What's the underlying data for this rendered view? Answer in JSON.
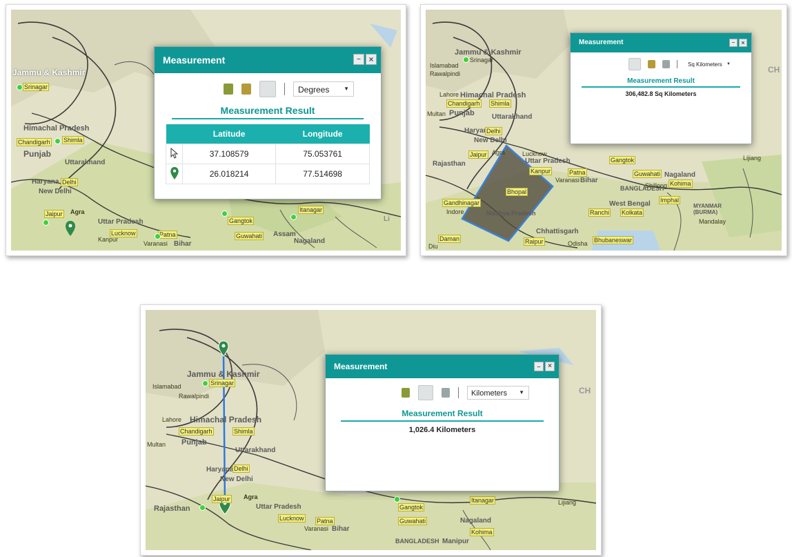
{
  "windows": [
    {
      "title": "Measurement",
      "unit": "Degrees",
      "result_heading": "Measurement Result",
      "columns": [
        "Latitude",
        "Longitude"
      ],
      "rows": [
        {
          "icon": "cursor-icon",
          "latitude": "37.108579",
          "longitude": "75.053761"
        },
        {
          "icon": "map-marker-icon",
          "latitude": "26.018214",
          "longitude": "77.514698"
        }
      ],
      "minimize": "–",
      "close": "×"
    },
    {
      "title": "Measurement",
      "unit": "Sq Kilometers",
      "result_heading": "Measurement Result",
      "result": "306,482.8 Sq Kilometers",
      "minimize": "–",
      "close": "×"
    },
    {
      "title": "Measurement",
      "unit": "Kilometers",
      "result_heading": "Measurement Result",
      "result": "1,026.4 Kilometers",
      "minimize": "–",
      "close": "×"
    }
  ],
  "map_labels": {
    "m1": [
      "Jammu & Kashmir",
      "Srinagar",
      "Himachal Pradesh",
      "Shimla",
      "Chandigarh",
      "Punjab",
      "Uttarakhand",
      "Haryana",
      "Delhi",
      "New Delhi",
      "Jaipur",
      "Agra",
      "Uttar Pradesh",
      "Lucknow",
      "Kanpur",
      "Patna",
      "Varanasi",
      "Bihar",
      "Gangtok",
      "Guwahati",
      "Itanagar",
      "Nagaland",
      "Assam",
      "Li"
    ],
    "m2": [
      "Jammu & Kashmir",
      "Srinagar",
      "Islamabad",
      "Rawalpindi",
      "Lahore",
      "Himachal Pradesh",
      "Chandigarh",
      "Shimla",
      "Punjab",
      "Multan",
      "Uttarakhand",
      "Haryana",
      "Delhi",
      "New Delhi",
      "Jaipur",
      "Agra",
      "Lucknow",
      "Rajasthan",
      "Uttar Pradesh",
      "Kanpur",
      "Patna",
      "Varanasi",
      "Bihar",
      "Gandhinagar",
      "Indore",
      "Bhopal",
      "Madhya Pradesh",
      "Daman",
      "Diu",
      "Raipur",
      "Chhattisgarh",
      "Odisha",
      "Bhubaneswar",
      "Ranchi",
      "West Bengal",
      "Kolkata",
      "BANGLADESH",
      "Gangtok",
      "Guwahati",
      "Shillong",
      "Nagaland",
      "Kohima",
      "Imphal",
      "MYANMAR (BURMA)",
      "Mandalay",
      "Lijiang",
      "CH"
    ],
    "m3": [
      "Jammu & Kashmir",
      "Srinagar",
      "Islamabad",
      "Rawalpindi",
      "Lahore",
      "Himachal Pradesh",
      "Chandigarh",
      "Shimla",
      "Punjab",
      "Multan",
      "Uttarakhand",
      "Haryana",
      "Delhi",
      "New Delhi",
      "Jaipur",
      "Agra",
      "Rajasthan",
      "Uttar Pradesh",
      "Lucknow",
      "Patna",
      "Varanasi",
      "Bihar",
      "Gangtok",
      "Guwahati",
      "Itanagar",
      "Nagaland",
      "Kohima",
      "Lijiang",
      "BANGLADESH",
      "Manipur",
      "CH"
    ]
  }
}
